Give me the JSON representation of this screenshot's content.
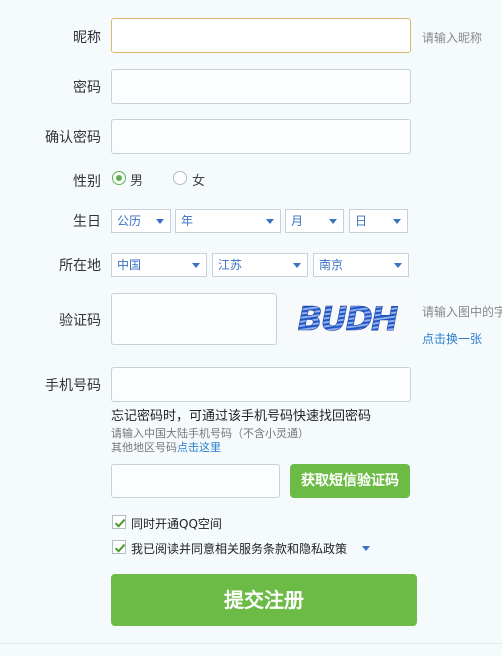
{
  "fields": {
    "nickname": {
      "label": "昵称",
      "hint": "请输入昵称",
      "value": ""
    },
    "password": {
      "label": "密码",
      "value": ""
    },
    "confirm_password": {
      "label": "确认密码",
      "value": ""
    },
    "gender": {
      "label": "性别",
      "options": [
        "男",
        "女"
      ],
      "selected": "男"
    },
    "birthday": {
      "label": "生日",
      "calendar": "公历",
      "year": "年",
      "month": "月",
      "day": "日"
    },
    "location": {
      "label": "所在地",
      "country": "中国",
      "province": "江苏",
      "city": "南京"
    },
    "captcha": {
      "label": "验证码",
      "value": "",
      "image_text": "BUDH",
      "hint": "请输入图中的字",
      "refresh_link": "点击换一张"
    },
    "phone": {
      "label": "手机号码",
      "value": "",
      "forgot_note": "忘记密码时，可通过该手机号码快速找回密码",
      "mainland_note": "请输入中国大陆手机号码（不含小灵通）",
      "other_region_prefix": "其他地区号码",
      "other_region_link": "点击这里"
    },
    "sms": {
      "value": "",
      "button": "获取短信验证码"
    }
  },
  "options": {
    "open_qzone": {
      "label": "同时开通QQ空间",
      "checked": true
    },
    "agree_terms": {
      "label": "我已阅读并同意相关服务条款和隐私政策",
      "checked": true
    }
  },
  "submit": {
    "label": "提交注册"
  },
  "colors": {
    "accent_green": "#6cbb46",
    "link_blue": "#2a7fd0",
    "focus_border": "#d8b872"
  }
}
